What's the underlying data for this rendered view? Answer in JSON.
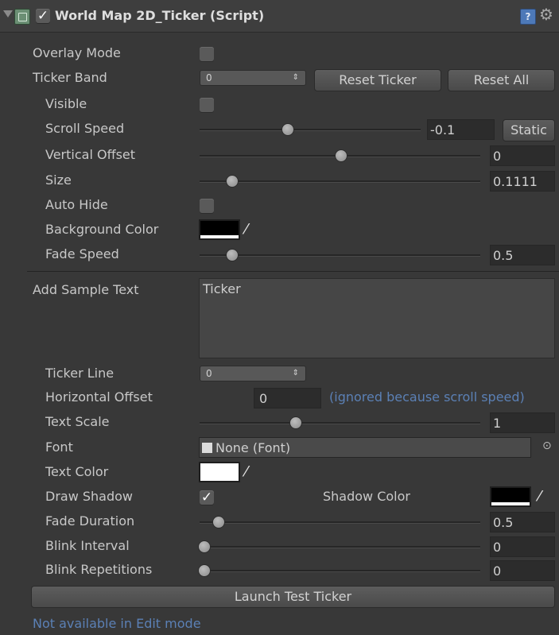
{
  "header": {
    "title": "World Map 2D_Ticker (Script)",
    "enabled": true
  },
  "overlay_mode": {
    "label": "Overlay Mode",
    "checked": false
  },
  "ticker_band": {
    "label": "Ticker Band",
    "value": "0",
    "reset_ticker_label": "Reset Ticker",
    "reset_all_label": "Reset All"
  },
  "visible": {
    "label": "Visible",
    "checked": false
  },
  "scroll_speed": {
    "label": "Scroll Speed",
    "value": "-0.1",
    "static_label": "Static",
    "slider_fraction": 0.45
  },
  "vertical_offset": {
    "label": "Vertical Offset",
    "value": "0",
    "slider_fraction": 0.5
  },
  "size": {
    "label": "Size",
    "value": "0.1111",
    "slider_fraction": 0.11
  },
  "auto_hide": {
    "label": "Auto Hide",
    "checked": false
  },
  "background_color": {
    "label": "Background Color",
    "color": "#000000"
  },
  "fade_speed": {
    "label": "Fade Speed",
    "value": "0.5",
    "slider_fraction": 0.1
  },
  "sample_text": {
    "label": "Add Sample Text",
    "value": "Ticker"
  },
  "ticker_line": {
    "label": "Ticker Line",
    "value": "0"
  },
  "horizontal_offset": {
    "label": "Horizontal Offset",
    "value": "0",
    "note": "(ignored because scroll speed)"
  },
  "text_scale": {
    "label": "Text Scale",
    "value": "1",
    "slider_fraction": 0.35
  },
  "font": {
    "label": "Font",
    "value": "None (Font)"
  },
  "text_color": {
    "label": "Text Color",
    "color": "#ffffff"
  },
  "draw_shadow": {
    "label": "Draw Shadow",
    "checked": true,
    "shadow_label": "Shadow Color",
    "shadow_color": "#000000"
  },
  "fade_duration": {
    "label": "Fade Duration",
    "value": "0.5",
    "slider_fraction": 0.06
  },
  "blink_interval": {
    "label": "Blink Interval",
    "value": "0",
    "slider_fraction": 0
  },
  "blink_repetitions": {
    "label": "Blink Repetitions",
    "value": "0",
    "slider_fraction": 0
  },
  "launch_label": "Launch Test Ticker",
  "status_text": "Not available in Edit mode",
  "icons": {
    "fold": "fold-arrow-icon",
    "script": "script-icon",
    "help": "help-icon",
    "gear": "gear-icon",
    "dropper": "eyedropper-icon",
    "object_picker": "object-picker-icon"
  }
}
